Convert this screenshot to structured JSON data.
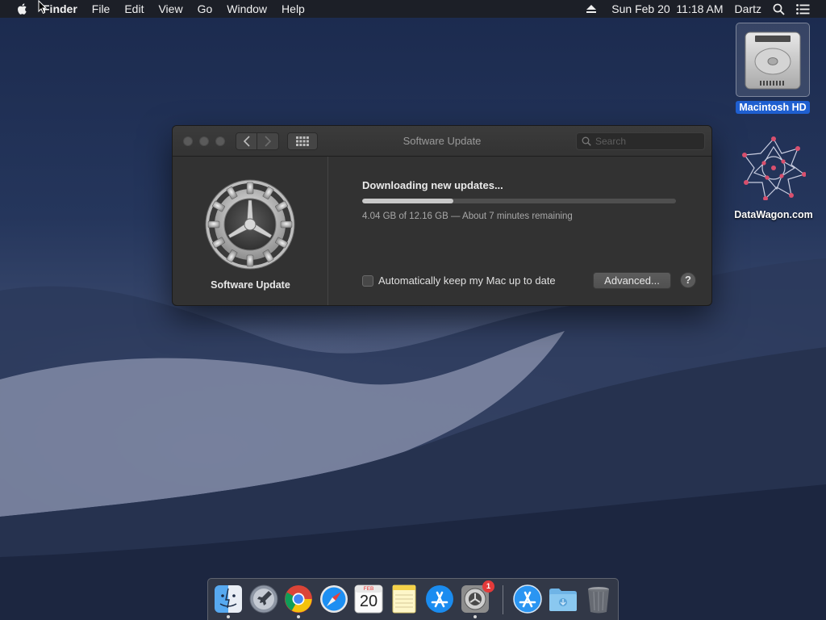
{
  "menubar": {
    "app_name": "Finder",
    "items": [
      "File",
      "Edit",
      "View",
      "Go",
      "Window",
      "Help"
    ],
    "clock": "Sun Feb 20  11:18 AM",
    "user": "Dartz"
  },
  "desktop": {
    "icons": [
      {
        "label": "Macintosh HD",
        "icon": "hard-drive-icon",
        "selected": true
      },
      {
        "label": "DataWagon.com",
        "icon": "datawagon-logo-icon",
        "selected": false
      }
    ]
  },
  "window": {
    "title": "Software Update",
    "search_placeholder": "Search",
    "pane_name": "Software Update",
    "status_title": "Downloading new updates...",
    "progress_fraction": 0.29,
    "progress_detail": "4.04 GB of 12.16 GB — About 7 minutes remaining",
    "auto_update_label": "Automatically keep my Mac up to date",
    "auto_update_checked": false,
    "advanced_label": "Advanced...",
    "help_label": "?"
  },
  "dock": {
    "items": [
      {
        "name": "finder",
        "icon": "finder-icon",
        "running": true
      },
      {
        "name": "launchpad",
        "icon": "launchpad-icon",
        "running": false
      },
      {
        "name": "chrome",
        "icon": "chrome-icon",
        "running": true
      },
      {
        "name": "safari",
        "icon": "safari-icon",
        "running": false
      },
      {
        "name": "calendar",
        "icon": "calendar-icon",
        "running": false,
        "month": "FEB",
        "day": "20"
      },
      {
        "name": "notes",
        "icon": "notes-icon",
        "running": false
      },
      {
        "name": "app-store",
        "icon": "app-store-icon",
        "running": false
      },
      {
        "name": "system-preferences",
        "icon": "gear-icon",
        "running": true,
        "badge": "1"
      },
      {
        "name": "applications",
        "icon": "app-store-icon",
        "running": false
      },
      {
        "name": "downloads",
        "icon": "folder-icon",
        "running": false
      },
      {
        "name": "trash",
        "icon": "trash-icon",
        "running": false
      }
    ]
  },
  "colors": {
    "selection_blue": "#1f5fd0",
    "window_bg": "#323232",
    "badge_red": "#e43a3a"
  }
}
